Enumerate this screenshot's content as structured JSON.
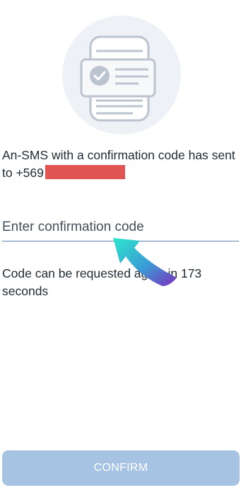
{
  "illustration": {
    "icon": "phone-with-sms-document-icon",
    "background_color": "#eef1f6"
  },
  "message": {
    "text": "An-SMS with a confirmation code has sent to +569",
    "redaction_color": "#e05454"
  },
  "code_input": {
    "placeholder": "Enter confirmation code",
    "value": ""
  },
  "resend_note": {
    "text": "Code can be requested again in 173 seconds"
  },
  "overlay": {
    "icon": "curved-arrow-icon",
    "colors": [
      "#2ee6cc",
      "#3a7bd5",
      "#7b2fbe"
    ]
  },
  "confirm_button": {
    "label": "CONFIRM",
    "background_color": "#a7c3e3"
  }
}
